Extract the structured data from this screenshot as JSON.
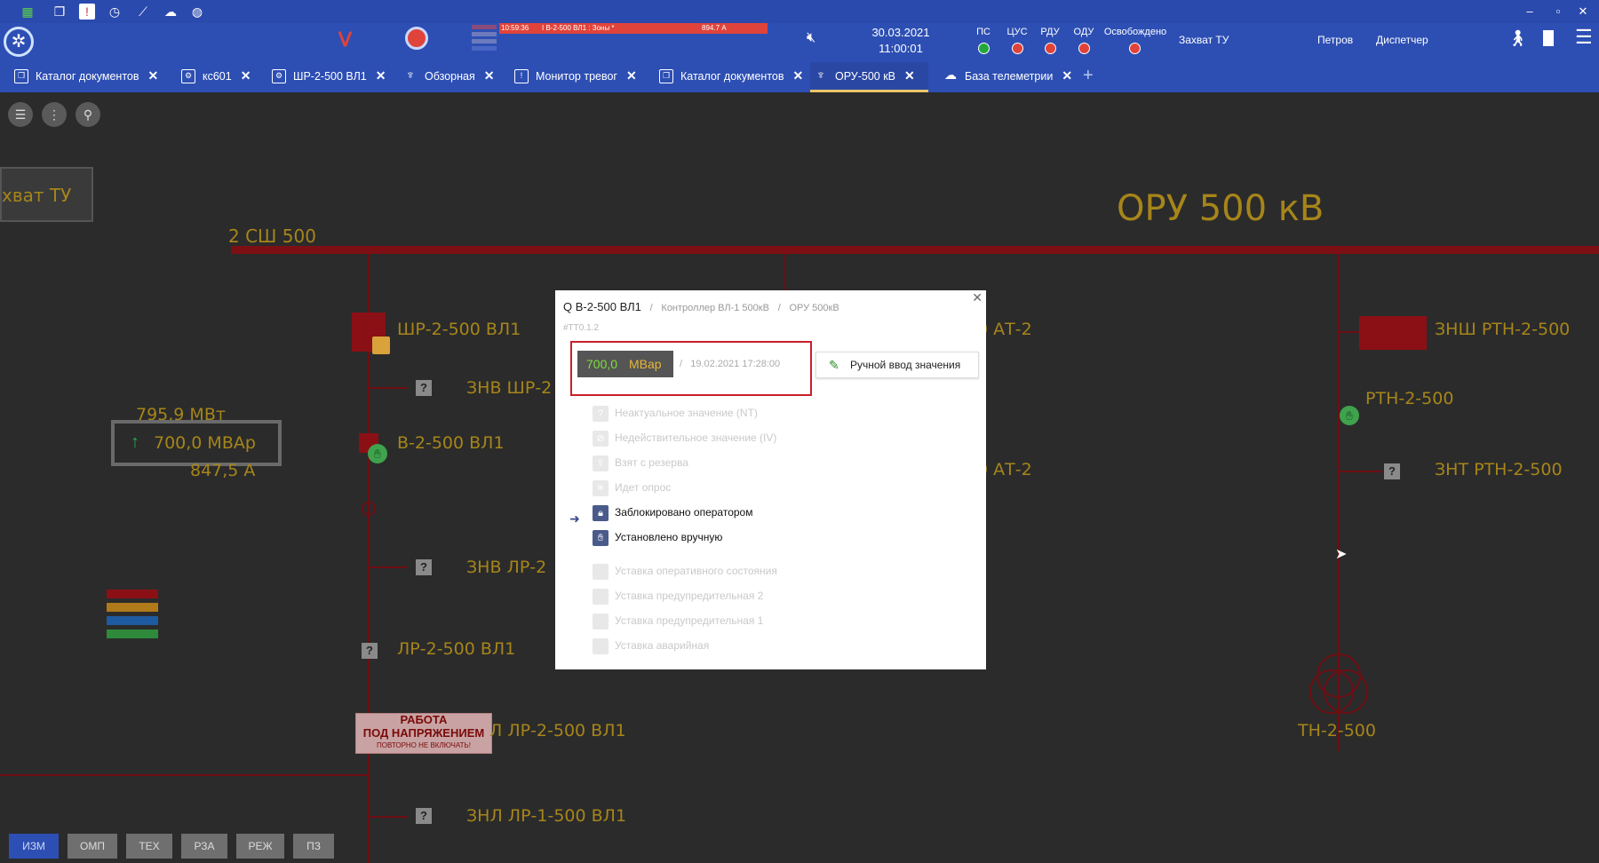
{
  "colors": {
    "topbar": "#2d4fb4",
    "canvas": "#2b2b2b",
    "scheme_text": "#a6851a",
    "bus": "#7d0f14",
    "alert": "#c8202a",
    "value_green": "#7ee03a",
    "value_unit": "#e6b63c"
  },
  "system_icons": [
    "grid-icon",
    "documents-icon",
    "alert-icon",
    "history-icon",
    "chart-icon",
    "cloud-icon",
    "globe-icon"
  ],
  "window_controls": {
    "minimize": "–",
    "restore": "▫",
    "close": "✕"
  },
  "header": {
    "alarm": {
      "time": "10:59:36",
      "text": "I В-2-500 ВЛ1 : Зоны *",
      "value": "894.7 А"
    },
    "date": "30.03.2021",
    "time": "11:00:01",
    "indicators": [
      {
        "label": "ПС",
        "color": "#22a83a"
      },
      {
        "label": "ЦУС",
        "color": "#e0433a"
      },
      {
        "label": "РДУ",
        "color": "#e0433a"
      },
      {
        "label": "ОДУ",
        "color": "#e0433a"
      },
      {
        "label": "Освобождено",
        "color": "#e0433a"
      }
    ],
    "capture": "Захват ТУ",
    "user": "Петров",
    "role": "Диспетчер"
  },
  "tabs": [
    {
      "label": "Каталог документов",
      "icon": "documents-icon"
    },
    {
      "label": "кс601",
      "icon": "scheme-icon"
    },
    {
      "label": "ШР-2-500 ВЛ1",
      "icon": "scheme-icon"
    },
    {
      "label": "Обзорная",
      "icon": "tower-icon"
    },
    {
      "label": "Монитор тревог",
      "icon": "alert-icon"
    },
    {
      "label": "Каталог документов",
      "icon": "documents-icon"
    },
    {
      "label": "ОРУ-500 кВ",
      "icon": "tower-icon",
      "active": true
    },
    {
      "label": "База телеметрии",
      "icon": "cloud-icon"
    }
  ],
  "scheme": {
    "title": "ОРУ 500 кВ",
    "capture_button": "хват ТУ",
    "bus_label": "2 СШ 500",
    "labels": {
      "shr_vl1": "ШР-2-500 ВЛ1",
      "znv_shr": "ЗНВ ШР-2",
      "v_vl1": "В-2-500 ВЛ1",
      "znv_lr": "ЗНВ ЛР-2",
      "lr_vl1": "ЛР-2-500 ВЛ1",
      "znl_lr2": "Л ЛР-2-500 ВЛ1",
      "znl_lr1": "ЗНЛ ЛР-1-500 ВЛ1",
      "at2_top": "0 АТ-2",
      "at2_mid": "0 АТ-2",
      "znsh_rtn": "ЗНШ РТН-2-500",
      "rtn": "РТН-2-500",
      "znt_rtn": "ЗНТ РТН-2-500",
      "tn": "ТН-2-500"
    },
    "measure": {
      "p": "795,9  МВт",
      "q": "700,0  МВАр",
      "i": "847,5  А"
    },
    "work_sign": {
      "line1": "РАБОТА",
      "line2": "ПОД НАПРЯЖЕНИЕМ",
      "line3": "ПОВТОРНО НЕ ВКЛЮЧАТЬ!"
    },
    "bottom_tabs": [
      "ИЗМ",
      "ОМП",
      "ТЕХ",
      "РЗА",
      "РЕЖ",
      "ПЗ"
    ]
  },
  "popup": {
    "title": "Q В-2-500 ВЛ1",
    "crumbs": [
      "Контроллер ВЛ-1 500кВ",
      "ОРУ 500кВ"
    ],
    "id": "#ТТ0.1.2",
    "value": "700,0",
    "unit": "МВар",
    "timestamp": "19.02.2021 17:28:00",
    "manual_button": "Ручной ввод значения",
    "flags": [
      {
        "label": "Неактуальное значение (NT)",
        "icon": "question-icon",
        "on": false
      },
      {
        "label": "Недействительное значение (IV)",
        "icon": "invalid-icon",
        "on": false
      },
      {
        "label": "Взят с резерва",
        "icon": "reserve-icon",
        "on": false
      },
      {
        "label": "Идет опрос",
        "icon": "polling-icon",
        "on": false
      },
      {
        "label": "Заблокировано оператором",
        "icon": "lock-icon",
        "on": true
      },
      {
        "label": "Установлено вручную",
        "icon": "hand-icon",
        "on": true
      },
      {
        "label": "Уставка оперативного состояния",
        "icon": "",
        "on": false
      },
      {
        "label": "Уставка предупредительная 2",
        "icon": "",
        "on": false
      },
      {
        "label": "Уставка предупредительная 1",
        "icon": "",
        "on": false
      },
      {
        "label": "Уставка аварийная",
        "icon": "",
        "on": false
      }
    ]
  }
}
